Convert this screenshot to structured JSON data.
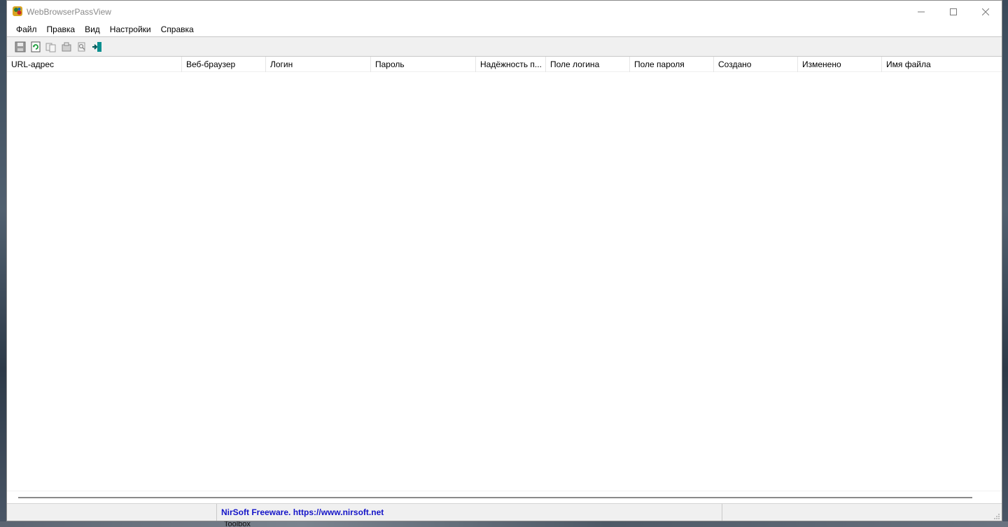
{
  "window": {
    "title": "WebBrowserPassView"
  },
  "menu": [
    {
      "label": "Файл"
    },
    {
      "label": "Правка"
    },
    {
      "label": "Вид"
    },
    {
      "label": "Настройки"
    },
    {
      "label": "Справка"
    }
  ],
  "toolbar": [
    {
      "icon": "save-icon",
      "tooltip": ""
    },
    {
      "icon": "refresh-icon",
      "tooltip": ""
    },
    {
      "icon": "copy-icon",
      "tooltip": ""
    },
    {
      "icon": "properties-icon",
      "tooltip": ""
    },
    {
      "icon": "find-icon",
      "tooltip": ""
    },
    {
      "icon": "exit-icon",
      "tooltip": ""
    }
  ],
  "columns": [
    {
      "label": "URL-адрес"
    },
    {
      "label": "Веб-браузер"
    },
    {
      "label": "Логин"
    },
    {
      "label": "Пароль"
    },
    {
      "label": "Надёжность п..."
    },
    {
      "label": "Поле логина"
    },
    {
      "label": "Поле пароля"
    },
    {
      "label": "Создано"
    },
    {
      "label": "Изменено"
    },
    {
      "label": "Имя файла"
    }
  ],
  "rows": [],
  "status": {
    "pane1": "",
    "link": "NirSoft Freeware. https://www.nirsoft.net"
  },
  "desktop": {
    "caption": "Toolbox"
  },
  "colors": {
    "status_link": "#1414c8",
    "toolbar_bg": "#f0f0f0",
    "title_text": "#8a8a8a"
  }
}
